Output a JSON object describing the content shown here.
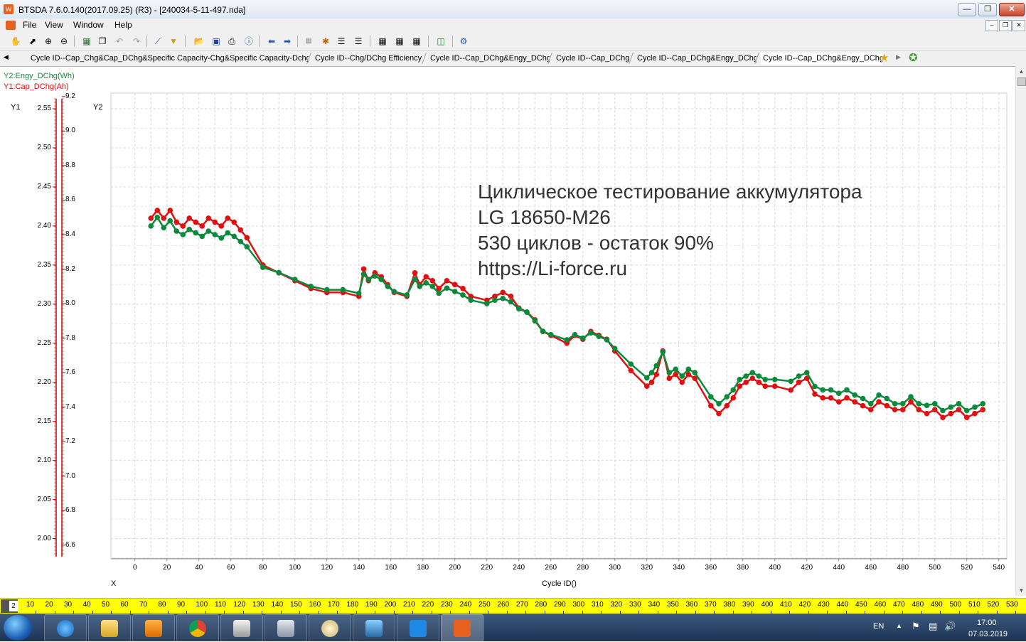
{
  "window": {
    "title": "BTSDA 7.6.0.140(2017.09.25) (R3) - [240034-5-11-497.nda]"
  },
  "menu": [
    "File",
    "View",
    "Window",
    "Help"
  ],
  "tabs": [
    "Cycle ID--Cap_Chg&Cap_DChg&Specific Capacity-Chg&Specific Capacity-Dchg",
    "Cycle ID--Chg/DChg Efficiency",
    "Cycle ID--Cap_DChg&Engy_DChg",
    "Cycle ID--Cap_DChg",
    "Cycle ID--Cap_DChg&Engy_DChg",
    "Cycle ID--Cap_DChg&Engy_DChg"
  ],
  "legend": {
    "y2": "Y2:Engy_DChg(Wh)",
    "y1": "Y1:Cap_DChg(Ah)"
  },
  "axes": {
    "y1_title": "Y1",
    "y2_title": "Y2",
    "x_title": "X",
    "x_label": "Cycle ID()"
  },
  "overlay_text": [
    "Циклическое тестирование аккумулятора",
    "LG 18650-M26",
    "530 циклов - остаток 90%",
    "https://Li-force.ru"
  ],
  "ruler": {
    "position": "2",
    "labels": [
      "10",
      "20",
      "30",
      "40",
      "50",
      "60",
      "70",
      "80",
      "90",
      "100",
      "110",
      "120",
      "130",
      "140",
      "150",
      "160",
      "170",
      "180",
      "190",
      "200",
      "210",
      "220",
      "230",
      "240",
      "250",
      "260",
      "270",
      "280",
      "290",
      "300",
      "310",
      "320",
      "330",
      "340",
      "350",
      "360",
      "370",
      "380",
      "390",
      "400",
      "410",
      "420",
      "430",
      "440",
      "450",
      "460",
      "470",
      "480",
      "490",
      "500",
      "510",
      "520",
      "530"
    ]
  },
  "taskbar": {
    "lang": "EN",
    "time": "17:00",
    "date": "07.03.2019"
  },
  "colors": {
    "cap_series": "#e01010",
    "energy_series": "#0a8a3a",
    "ruler": "#ffff00",
    "axis_red": "#c00000"
  },
  "chart_data": {
    "type": "scatter",
    "xlabel": "Cycle ID()",
    "xlim": [
      -15,
      545
    ],
    "x_ticks": [
      "0",
      "20",
      "40",
      "60",
      "80",
      "100",
      "120",
      "140",
      "160",
      "180",
      "200",
      "220",
      "240",
      "260",
      "280",
      "300",
      "320",
      "340",
      "360",
      "380",
      "400",
      "420",
      "440",
      "460",
      "480",
      "500",
      "520",
      "540"
    ],
    "y1_ticks": [
      "2.55",
      "2.50",
      "2.45",
      "2.40",
      "2.35",
      "2.30",
      "2.25",
      "2.20",
      "2.15",
      "2.10",
      "2.05",
      "2.00"
    ],
    "y2_ticks": [
      "9.2",
      "9.0",
      "8.8",
      "8.6",
      "8.4",
      "8.2",
      "8.0",
      "7.8",
      "7.6",
      "7.4",
      "7.2",
      "7.0",
      "6.8",
      "6.6"
    ],
    "ylim_y1": [
      1.975,
      2.57
    ],
    "ylim_y2": [
      6.525,
      9.22
    ],
    "grid": true,
    "series": [
      {
        "name": "Y1:Cap_DChg(Ah)",
        "axis": "y1",
        "x": [
          10,
          14,
          18,
          22,
          26,
          30,
          34,
          38,
          42,
          46,
          50,
          54,
          58,
          62,
          66,
          70,
          80,
          90,
          100,
          110,
          120,
          130,
          140,
          143,
          146,
          150,
          154,
          158,
          162,
          170,
          175,
          178,
          182,
          186,
          190,
          195,
          200,
          205,
          210,
          220,
          225,
          230,
          235,
          240,
          245,
          250,
          255,
          260,
          270,
          275,
          280,
          285,
          290,
          295,
          300,
          310,
          320,
          323,
          326,
          330,
          334,
          338,
          342,
          346,
          350,
          360,
          365,
          370,
          374,
          378,
          382,
          386,
          390,
          394,
          400,
          410,
          415,
          420,
          425,
          430,
          435,
          440,
          445,
          450,
          455,
          460,
          465,
          470,
          475,
          480,
          485,
          490,
          495,
          500,
          505,
          510,
          515,
          520,
          525,
          530
        ],
        "y": [
          2.41,
          2.42,
          2.41,
          2.42,
          2.405,
          2.4,
          2.41,
          2.405,
          2.4,
          2.41,
          2.405,
          2.4,
          2.41,
          2.405,
          2.395,
          2.385,
          2.35,
          2.34,
          2.33,
          2.32,
          2.315,
          2.315,
          2.31,
          2.345,
          2.33,
          2.34,
          2.335,
          2.325,
          2.315,
          2.31,
          2.34,
          2.325,
          2.335,
          2.33,
          2.32,
          2.33,
          2.325,
          2.32,
          2.31,
          2.305,
          2.31,
          2.315,
          2.31,
          2.295,
          2.29,
          2.28,
          2.265,
          2.26,
          2.25,
          2.26,
          2.255,
          2.265,
          2.26,
          2.255,
          2.24,
          2.215,
          2.195,
          2.2,
          2.21,
          2.24,
          2.205,
          2.21,
          2.2,
          2.21,
          2.205,
          2.17,
          2.16,
          2.17,
          2.18,
          2.195,
          2.2,
          2.205,
          2.2,
          2.195,
          2.195,
          2.19,
          2.2,
          2.205,
          2.185,
          2.18,
          2.18,
          2.175,
          2.18,
          2.175,
          2.17,
          2.165,
          2.175,
          2.17,
          2.165,
          2.165,
          2.175,
          2.165,
          2.16,
          2.165,
          2.155,
          2.16,
          2.165,
          2.155,
          2.16,
          2.165
        ]
      },
      {
        "name": "Y2:Engy_DChg(Wh)",
        "axis": "y2",
        "x": [
          10,
          14,
          18,
          22,
          26,
          30,
          34,
          38,
          42,
          46,
          50,
          54,
          58,
          62,
          66,
          70,
          80,
          90,
          100,
          110,
          120,
          130,
          140,
          143,
          146,
          150,
          154,
          158,
          162,
          170,
          175,
          178,
          182,
          186,
          190,
          195,
          200,
          205,
          210,
          220,
          225,
          230,
          235,
          240,
          245,
          250,
          255,
          260,
          270,
          275,
          280,
          285,
          290,
          295,
          300,
          310,
          320,
          323,
          326,
          330,
          334,
          338,
          342,
          346,
          350,
          360,
          365,
          370,
          374,
          378,
          382,
          386,
          390,
          394,
          400,
          410,
          415,
          420,
          425,
          430,
          435,
          440,
          445,
          450,
          455,
          460,
          465,
          470,
          475,
          480,
          485,
          490,
          495,
          500,
          505,
          510,
          515,
          520,
          525,
          530
        ],
        "y": [
          8.45,
          8.5,
          8.44,
          8.48,
          8.42,
          8.4,
          8.43,
          8.41,
          8.39,
          8.42,
          8.4,
          8.38,
          8.41,
          8.39,
          8.36,
          8.33,
          8.21,
          8.18,
          8.14,
          8.1,
          8.08,
          8.08,
          8.06,
          8.17,
          8.14,
          8.16,
          8.14,
          8.1,
          8.07,
          8.05,
          8.14,
          8.1,
          8.12,
          8.1,
          8.06,
          8.09,
          8.07,
          8.05,
          8.02,
          8.0,
          8.02,
          8.03,
          8.01,
          7.97,
          7.95,
          7.9,
          7.84,
          7.82,
          7.79,
          7.82,
          7.8,
          7.83,
          7.81,
          7.79,
          7.74,
          7.65,
          7.57,
          7.6,
          7.64,
          7.72,
          7.6,
          7.62,
          7.58,
          7.62,
          7.6,
          7.46,
          7.42,
          7.46,
          7.5,
          7.56,
          7.58,
          7.6,
          7.58,
          7.56,
          7.56,
          7.55,
          7.58,
          7.6,
          7.52,
          7.5,
          7.5,
          7.48,
          7.5,
          7.47,
          7.45,
          7.42,
          7.47,
          7.45,
          7.42,
          7.42,
          7.46,
          7.42,
          7.41,
          7.42,
          7.38,
          7.4,
          7.42,
          7.38,
          7.4,
          7.42
        ]
      }
    ]
  }
}
